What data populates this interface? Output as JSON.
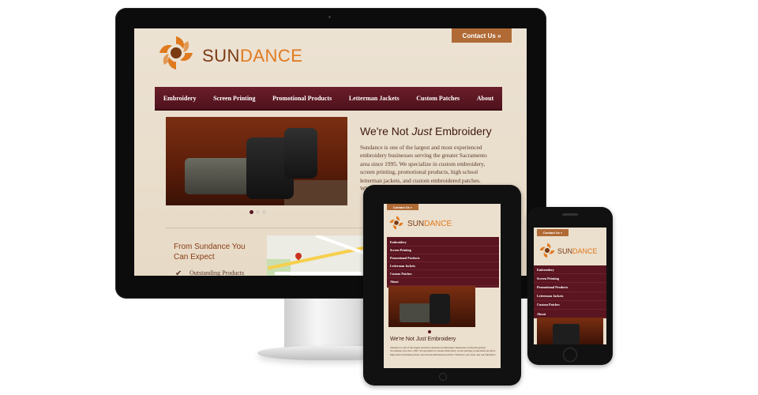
{
  "site": {
    "contact_label": "Contact Us »",
    "brand_part1": "SUN",
    "brand_part2": "DANCE",
    "nav": [
      "Embroidery",
      "Screen Printing",
      "Promotional Products",
      "Letterman Jackets",
      "Custom Patches",
      "About"
    ],
    "hero_title_before": "We're Not ",
    "hero_title_em": "Just",
    "hero_title_after": " Embroidery",
    "hero_text": "Sundance is one of the largest and most experienced embroidery businesses serving the greater Sacramento area since 1995. We specialize in custom embroidery, screen printing, promotional products, high school letterman jackets, and custom embroidered patches. Whatever your need, we can help.",
    "expect_title": "From Sundance You Can Expect",
    "expect_items": [
      "Outstanding Products"
    ],
    "tablet_text": "Sundance is one of the largest and most experienced embroidery businesses serving the greater Sacramento area since 1995. We specialize in custom embroidery, screen printing, promotional products, high school letterman jackets, and custom embroidered patches. Whatever your need, just ask Sundance!"
  },
  "colors": {
    "brand_orange": "#e07a1f",
    "brand_brown": "#7a3a12",
    "nav_maroon": "#5a1520",
    "contact_copper": "#b06a35"
  }
}
